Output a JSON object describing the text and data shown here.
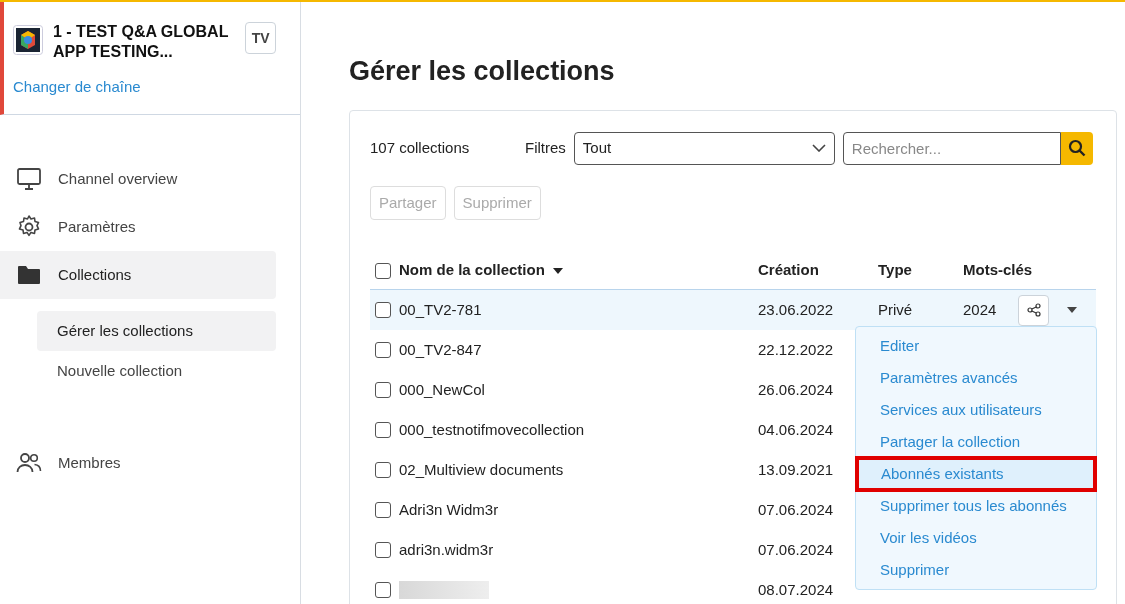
{
  "channel": {
    "name": "1 - TEST Q&A GLOBAL APP TESTING...",
    "badge": "TV",
    "change_link": "Changer de chaîne"
  },
  "sidebar": {
    "items": [
      {
        "kind": "monitor",
        "label": "Channel overview",
        "selected": false
      },
      {
        "kind": "gear",
        "label": "Paramètres",
        "selected": false
      },
      {
        "kind": "folder",
        "label": "Collections",
        "selected": true,
        "children": [
          {
            "label": "Gérer les collections",
            "selected": true
          },
          {
            "label": "Nouvelle collection",
            "selected": false
          }
        ]
      },
      {
        "kind": "people",
        "label": "Membres",
        "selected": false
      }
    ]
  },
  "page_title": "Gérer les collections",
  "toolbar": {
    "count": "107 collections",
    "filter_label": "Filtres",
    "filter_value": "Tout",
    "search": {
      "placeholder": "Rechercher..."
    },
    "buttons": [
      {
        "label": "Partager",
        "disabled": true
      },
      {
        "label": "Supprimer",
        "disabled": true
      }
    ]
  },
  "table": {
    "select_all_checked": false,
    "columns": [
      "Nom de la collection",
      "Création",
      "Type",
      "Mots-clés"
    ],
    "rows": [
      {
        "name": "00_TV2-781",
        "created": "23.06.2022",
        "type": "Privé",
        "keywords": "2024",
        "selected": true,
        "checked": false
      },
      {
        "name": "00_TV2-847",
        "created": "22.12.2022",
        "selected": false,
        "checked": false
      },
      {
        "name": "000_NewCol",
        "created": "26.06.2024",
        "selected": false,
        "checked": false
      },
      {
        "name": "000_testnotifmovecollection",
        "created": "04.06.2024",
        "selected": false,
        "checked": false
      },
      {
        "name": "02_Multiview documents",
        "created": "13.09.2021",
        "selected": false,
        "checked": false
      },
      {
        "name": "Adri3n Widm3r",
        "created": "07.06.2024",
        "selected": false,
        "checked": false
      },
      {
        "name": "adri3n.widm3r",
        "created": "07.06.2024",
        "selected": false,
        "checked": false
      },
      {
        "redacted": true,
        "created": "08.07.2024",
        "selected": false,
        "checked": false
      }
    ]
  },
  "context_menu": {
    "items": [
      {
        "label": "Editer",
        "selected": false
      },
      {
        "label": "Paramètres avancés",
        "selected": false
      },
      {
        "label": "Services aux utilisateurs",
        "selected": false
      },
      {
        "label": "Partager la collection",
        "selected": false
      },
      {
        "label": "Abonnés existants",
        "selected": true
      },
      {
        "label": "Supprimer tous les abonnés",
        "selected": false
      },
      {
        "label": "Voir les vidéos",
        "selected": false
      },
      {
        "label": "Supprimer",
        "selected": false
      }
    ]
  }
}
